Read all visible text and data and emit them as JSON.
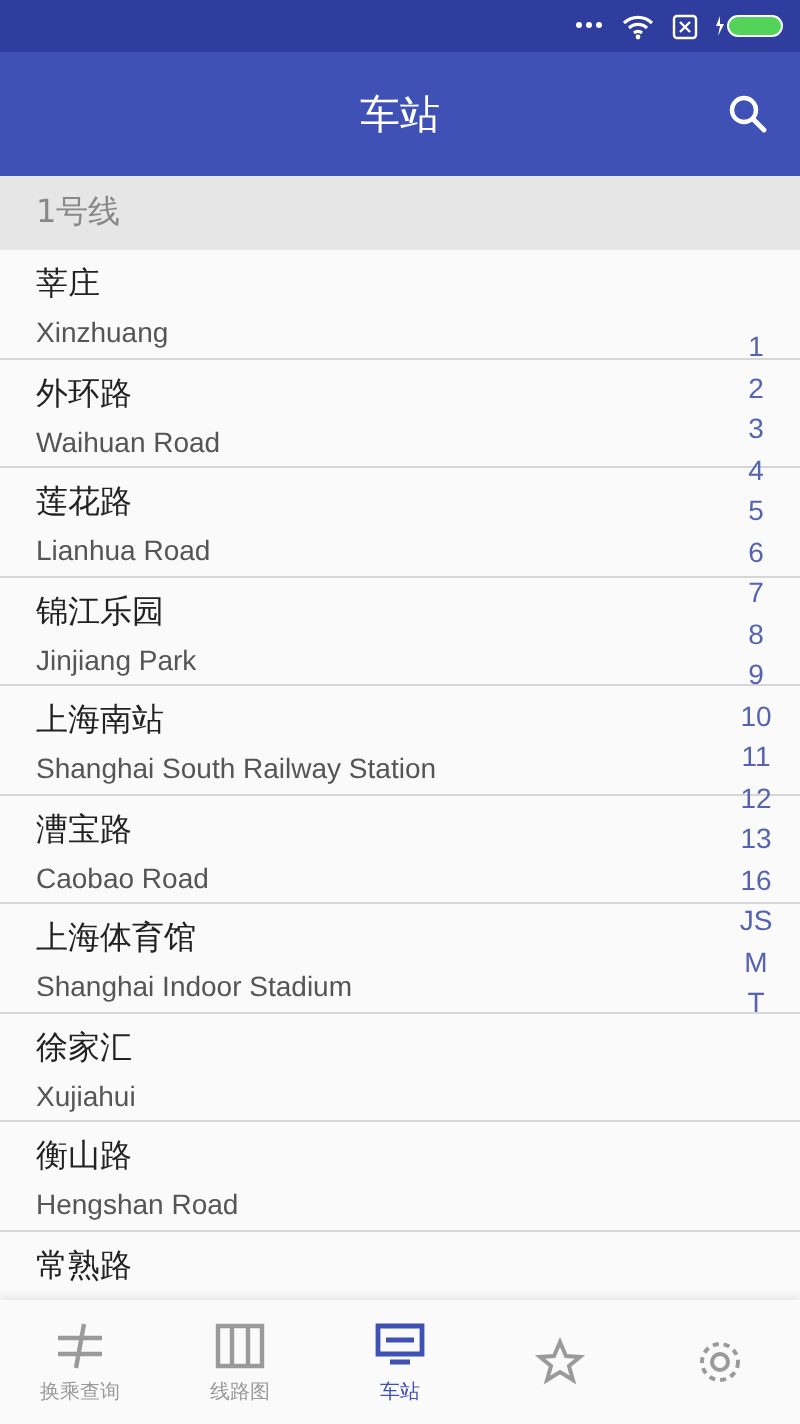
{
  "app_bar": {
    "title": "车站"
  },
  "section": {
    "title": "1号线"
  },
  "stations": [
    {
      "name": "莘庄",
      "pinyin": "Xinzhuang"
    },
    {
      "name": "外环路",
      "pinyin": "Waihuan Road"
    },
    {
      "name": "莲花路",
      "pinyin": "Lianhua Road"
    },
    {
      "name": "锦江乐园",
      "pinyin": "Jinjiang Park"
    },
    {
      "name": "上海南站",
      "pinyin": "Shanghai South Railway Station"
    },
    {
      "name": "漕宝路",
      "pinyin": "Caobao Road"
    },
    {
      "name": "上海体育馆",
      "pinyin": "Shanghai Indoor Stadium"
    },
    {
      "name": "徐家汇",
      "pinyin": "Xujiahui"
    },
    {
      "name": "衡山路",
      "pinyin": "Hengshan Road"
    },
    {
      "name": "常熟路"
    }
  ],
  "index": [
    "1",
    "2",
    "3",
    "4",
    "5",
    "6",
    "7",
    "8",
    "9",
    "10",
    "11",
    "12",
    "13",
    "16",
    "JS",
    "M",
    "T"
  ],
  "tabs": [
    {
      "label": "换乘查询",
      "selected": false
    },
    {
      "label": "线路图",
      "selected": false
    },
    {
      "label": "车站",
      "selected": true
    },
    {
      "selected": false
    },
    {
      "selected": false
    }
  ]
}
